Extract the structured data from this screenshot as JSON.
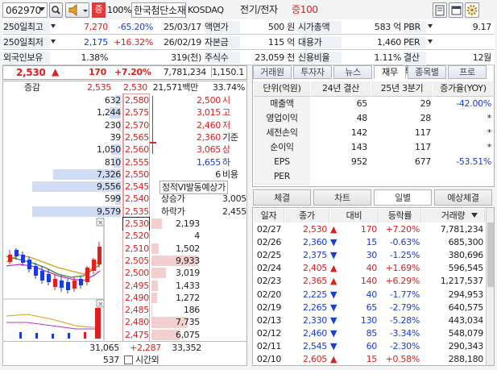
{
  "header": {
    "code": "062970",
    "credit_badge": "증",
    "percent_badge": "100%",
    "name": "한국첨단소재",
    "market": "KOSDAQ",
    "sector": "전기/전자",
    "margin": "증100"
  },
  "info": [
    {
      "l1": "250일최고",
      "v1": "7,270",
      "v2": "-65.20%",
      "v3": "25/03/17",
      "l2": "액면가",
      "v4": "500 원",
      "l3": "시가총액",
      "v5": "583 억",
      "l4": "PBR",
      "v6": "9.17"
    },
    {
      "l1": "250일최저",
      "v1": "2,175",
      "v2": "+16.32%",
      "v3": "26/02/19",
      "l2": "자본금",
      "v4": "115 억",
      "l3": "대용가",
      "v5": "1,460",
      "l4": "PER",
      "v6": ""
    },
    {
      "l1": "외국인보유",
      "v1": "1.38%",
      "v2": "",
      "v3": "319(천)",
      "l2": "주식수",
      "v4": "23,059 천",
      "l3": "신용비율",
      "v5": "1.11%",
      "l4": "결산월",
      "v6": "12월"
    }
  ],
  "quote": {
    "price": "2,530",
    "change": "170",
    "rate": "+7.20%",
    "volume": "7,781,234",
    "amount": "1,150.1"
  },
  "orderbook": {
    "col_label": "증감",
    "price_head": "2,535",
    "price_now": "2,530",
    "trade_value": "21,571백만",
    "strength": "33.74%",
    "asks": [
      {
        "qty": "632",
        "price": "2,580"
      },
      {
        "qty": "1,244",
        "price": "2,575"
      },
      {
        "qty": "230",
        "price": "2,570"
      },
      {
        "qty": "39",
        "price": "2,565"
      },
      {
        "qty": "1,050",
        "price": "2,560"
      },
      {
        "qty": "810",
        "price": "2,555"
      },
      {
        "qty": "7,326",
        "price": "2,550"
      },
      {
        "qty": "9,556",
        "price": "2,545"
      },
      {
        "qty": "599",
        "price": "2,540"
      },
      {
        "qty": "9,579",
        "price": "2,535"
      }
    ],
    "bids": [
      {
        "price": "2,530",
        "qty": "2,193"
      },
      {
        "price": "2,520",
        "qty": "4"
      },
      {
        "price": "2,510",
        "qty": "1,502"
      },
      {
        "price": "2,505",
        "qty": "9,933"
      },
      {
        "price": "2,500",
        "qty": "3,019"
      },
      {
        "price": "2,495",
        "qty": "1,433"
      },
      {
        "price": "2,490",
        "qty": "1,272"
      },
      {
        "price": "2,485",
        "qty": "186"
      },
      {
        "price": "2,480",
        "qty": "7,735"
      },
      {
        "price": "2,475",
        "qty": "6,075"
      }
    ],
    "side": [
      {
        "v": "2,500",
        "k": "시"
      },
      {
        "v": "3,015",
        "k": "고"
      },
      {
        "v": "2,460",
        "k": "저"
      },
      {
        "v": "2,360",
        "k": "기준"
      },
      {
        "v": "3,065",
        "k": "상"
      },
      {
        "v": "1,655",
        "k": "하"
      },
      {
        "v": "6",
        "k": "비용"
      }
    ],
    "vi_label": "정적VI발동예상가",
    "up_label": "상승가",
    "up_value": "3,005",
    "down_label": "하락가",
    "down_value": "2,455",
    "total_ask": "31,065",
    "total_diff": "+2,287",
    "total_bid": "33,352",
    "after_qty": "537",
    "after_label": "시간외"
  },
  "fin_tabs": [
    "거래원",
    "투자자",
    "뉴스",
    "재무",
    "종목별",
    "프로"
  ],
  "fin": {
    "headers": [
      "단위(억원)",
      "24년 결산",
      "25년 3분기",
      "증가율(YOY)"
    ],
    "rows": [
      {
        "k": "매출액",
        "a": "65",
        "b": "29",
        "c": "-42.00%"
      },
      {
        "k": "영업이익",
        "a": "48",
        "b": "28",
        "c": "*"
      },
      {
        "k": "세전손익",
        "a": "142",
        "b": "117",
        "c": "*"
      },
      {
        "k": "순이익",
        "a": "143",
        "b": "117",
        "c": "*"
      },
      {
        "k": "EPS",
        "a": "952",
        "b": "677",
        "c": "-53.51%"
      },
      {
        "k": "PER",
        "a": "",
        "b": "",
        "c": ""
      }
    ]
  },
  "daily_tabs": [
    "체결",
    "차트",
    "일별",
    "예상체결"
  ],
  "daily": {
    "headers": [
      "일자",
      "종가",
      "대비",
      "등락률",
      "거래량"
    ],
    "rows": [
      {
        "d": "02/27",
        "p": "2,530",
        "dir": "up",
        "c": "170",
        "r": "+7.20%",
        "v": "7,781,234"
      },
      {
        "d": "02/26",
        "p": "2,360",
        "dir": "down",
        "c": "15",
        "r": "-0.63%",
        "v": "685,300"
      },
      {
        "d": "02/25",
        "p": "2,375",
        "dir": "down",
        "c": "30",
        "r": "-1.25%",
        "v": "380,696"
      },
      {
        "d": "02/24",
        "p": "2,405",
        "dir": "up",
        "c": "40",
        "r": "+1.69%",
        "v": "596,545"
      },
      {
        "d": "02/23",
        "p": "2,365",
        "dir": "up",
        "c": "140",
        "r": "+6.29%",
        "v": "1,217,537"
      },
      {
        "d": "02/20",
        "p": "2,225",
        "dir": "down",
        "c": "40",
        "r": "-1.77%",
        "v": "294,953"
      },
      {
        "d": "02/19",
        "p": "2,265",
        "dir": "down",
        "c": "65",
        "r": "-2.79%",
        "v": "640,575"
      },
      {
        "d": "02/13",
        "p": "2,330",
        "dir": "down",
        "c": "130",
        "r": "-5.28%",
        "v": "443,034"
      },
      {
        "d": "02/12",
        "p": "2,460",
        "dir": "down",
        "c": "85",
        "r": "-3.34%",
        "v": "548,079"
      },
      {
        "d": "02/11",
        "p": "2,545",
        "dir": "down",
        "c": "60",
        "r": "-2.30%",
        "v": "290,343"
      },
      {
        "d": "02/10",
        "p": "2,605",
        "dir": "up",
        "c": "15",
        "r": "+0.58%",
        "v": "288,180"
      }
    ]
  },
  "colors": {
    "up": "#e0201c",
    "down": "#1a3cd8",
    "ask_bar": "#cfdcf2",
    "bid_bar": "#f3d0d0"
  }
}
